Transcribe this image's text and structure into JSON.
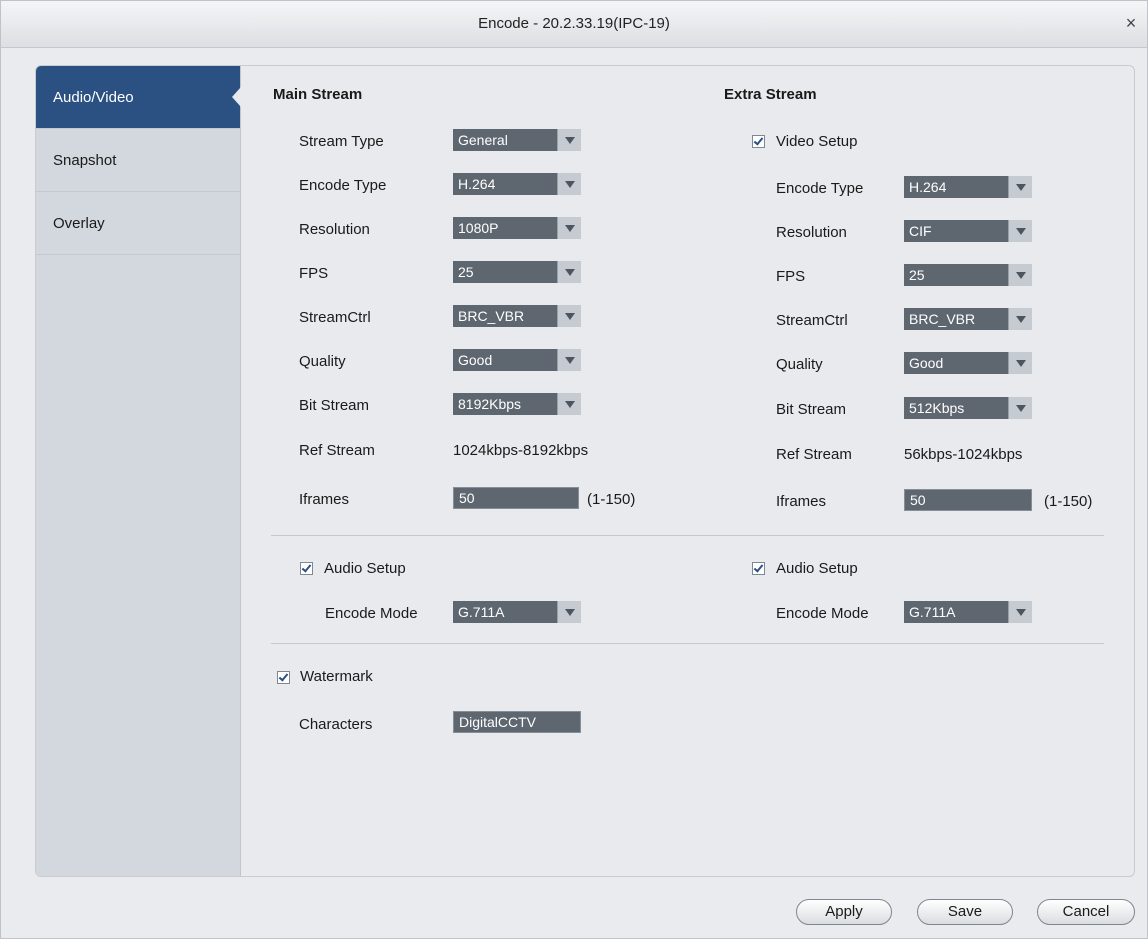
{
  "window": {
    "title": "Encode  - 20.2.33.19(IPC-19)",
    "close_glyph": "×"
  },
  "sidebar": {
    "items": [
      {
        "label": "Audio/Video",
        "active": true
      },
      {
        "label": "Snapshot",
        "active": false
      },
      {
        "label": "Overlay",
        "active": false
      }
    ]
  },
  "main": {
    "title": "Main Stream",
    "stream_type": {
      "label": "Stream Type",
      "value": "General"
    },
    "encode_type": {
      "label": "Encode Type",
      "value": "H.264"
    },
    "resolution": {
      "label": "Resolution",
      "value": "1080P"
    },
    "fps": {
      "label": "FPS",
      "value": "25"
    },
    "streamctrl": {
      "label": "StreamCtrl",
      "value": "BRC_VBR"
    },
    "quality": {
      "label": "Quality",
      "value": "Good"
    },
    "bit_stream": {
      "label": "Bit Stream",
      "value": "8192Kbps"
    },
    "ref_stream": {
      "label": "Ref Stream",
      "value": "1024kbps-8192kbps"
    },
    "iframes": {
      "label": "Iframes",
      "value": "50",
      "range": "(1-150)"
    },
    "audio": {
      "label": "Audio Setup",
      "checked": true,
      "encode_mode_label": "Encode Mode",
      "encode_mode": "G.711A"
    }
  },
  "extra": {
    "title": "Extra Stream",
    "video_setup": {
      "label": "Video Setup",
      "checked": true
    },
    "encode_type": {
      "label": "Encode Type",
      "value": "H.264"
    },
    "resolution": {
      "label": "Resolution",
      "value": "CIF"
    },
    "fps": {
      "label": "FPS",
      "value": "25"
    },
    "streamctrl": {
      "label": "StreamCtrl",
      "value": "BRC_VBR"
    },
    "quality": {
      "label": "Quality",
      "value": "Good"
    },
    "bit_stream": {
      "label": "Bit Stream",
      "value": "512Kbps"
    },
    "ref_stream": {
      "label": "Ref Stream",
      "value": "56kbps-1024kbps"
    },
    "iframes": {
      "label": "Iframes",
      "value": "50",
      "range": "(1-150)"
    },
    "audio": {
      "label": "Audio Setup",
      "checked": true,
      "encode_mode_label": "Encode Mode",
      "encode_mode": "G.711A"
    }
  },
  "watermark": {
    "label": "Watermark",
    "checked": true,
    "characters_label": "Characters",
    "characters": "DigitalCCTV"
  },
  "buttons": {
    "apply": "Apply",
    "save": "Save",
    "cancel": "Cancel"
  },
  "colors": {
    "sidebar_active": "#2b5183",
    "field_bg": "#5e6670",
    "window_bg": "#e9ebee"
  }
}
